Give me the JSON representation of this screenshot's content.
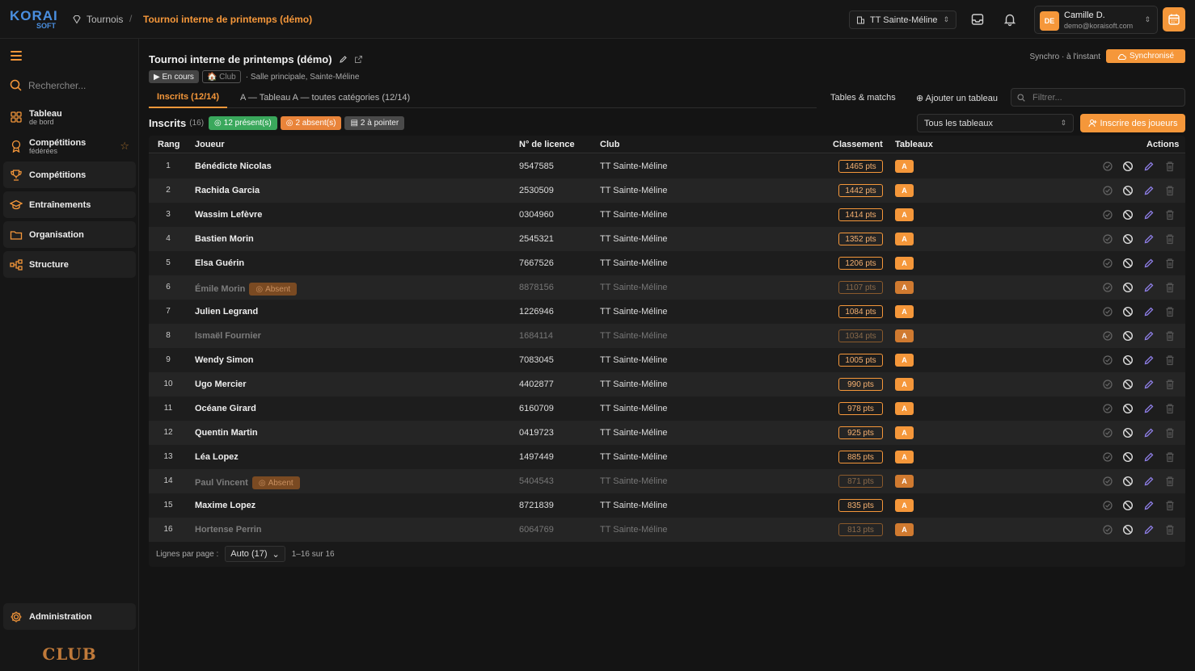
{
  "brand": {
    "logo_top": "KORAI",
    "logo_bottom": "SOFT",
    "accent": "#f5973a"
  },
  "breadcrumb": {
    "root": "Tournois",
    "separator": "/",
    "current": "Tournoi interne de printemps (démo)"
  },
  "header": {
    "club_selector": "TT Sainte-Méline",
    "user": {
      "initials": "DE",
      "name": "Camille D.",
      "email": "demo@koraisoft.com"
    }
  },
  "sidebar": {
    "search_placeholder": "Rechercher...",
    "items": [
      {
        "label": "Tableau",
        "sub": "de bord"
      },
      {
        "label": "Compétitions",
        "sub": "fédérées"
      },
      {
        "label": "Compétitions"
      },
      {
        "label": "Entraînements"
      },
      {
        "label": "Organisation"
      },
      {
        "label": "Structure"
      }
    ],
    "admin": "Administration",
    "club_logo": "CLUB"
  },
  "page": {
    "title": "Tournoi interne de printemps (démo)",
    "status_chip": "▶ En cours",
    "type_chip": "Club",
    "location": "· Salle principale, Sainte-Méline",
    "sync_label": "Synchro · à l'instant",
    "sync_button": "Synchronisé"
  },
  "tabs": {
    "active": "Inscrits (12/14)",
    "other": "A — Tableau A — toutes catégories (12/14)",
    "tables_link": "Tables & matchs",
    "add_table": "Ajouter un tableau",
    "filter_placeholder": "Filtrer..."
  },
  "inscrits": {
    "title": "Inscrits",
    "count": "(16)",
    "present": "12 présent(s)",
    "absent": "2 absent(s)",
    "to_check": "2 à pointer",
    "table_filter": "Tous les tableaux",
    "register_button": "Inscrire des joueurs",
    "absent_tag": "Absent"
  },
  "table": {
    "headers": {
      "rank": "Rang",
      "player": "Joueur",
      "license": "N° de licence",
      "club": "Club",
      "ranking": "Classement",
      "tables": "Tableaux",
      "actions": "Actions"
    },
    "rows": [
      {
        "rank": "1",
        "name": "Bénédicte Nicolas",
        "license": "9547585",
        "club": "TT Sainte-Méline",
        "pts": "1465 pts",
        "table": "A",
        "dim": false,
        "absent": false
      },
      {
        "rank": "2",
        "name": "Rachida Garcia",
        "license": "2530509",
        "club": "TT Sainte-Méline",
        "pts": "1442 pts",
        "table": "A",
        "dim": false,
        "absent": false
      },
      {
        "rank": "3",
        "name": "Wassim Lefèvre",
        "license": "0304960",
        "club": "TT Sainte-Méline",
        "pts": "1414 pts",
        "table": "A",
        "dim": false,
        "absent": false
      },
      {
        "rank": "4",
        "name": "Bastien Morin",
        "license": "2545321",
        "club": "TT Sainte-Méline",
        "pts": "1352 pts",
        "table": "A",
        "dim": false,
        "absent": false
      },
      {
        "rank": "5",
        "name": "Elsa Guérin",
        "license": "7667526",
        "club": "TT Sainte-Méline",
        "pts": "1206 pts",
        "table": "A",
        "dim": false,
        "absent": false
      },
      {
        "rank": "6",
        "name": "Émile Morin",
        "license": "8878156",
        "club": "TT Sainte-Méline",
        "pts": "1107 pts",
        "table": "A",
        "dim": true,
        "absent": true
      },
      {
        "rank": "7",
        "name": "Julien Legrand",
        "license": "1226946",
        "club": "TT Sainte-Méline",
        "pts": "1084 pts",
        "table": "A",
        "dim": false,
        "absent": false
      },
      {
        "rank": "8",
        "name": "Ismaël Fournier",
        "license": "1684114",
        "club": "TT Sainte-Méline",
        "pts": "1034 pts",
        "table": "A",
        "dim": true,
        "absent": false
      },
      {
        "rank": "9",
        "name": "Wendy Simon",
        "license": "7083045",
        "club": "TT Sainte-Méline",
        "pts": "1005 pts",
        "table": "A",
        "dim": false,
        "absent": false
      },
      {
        "rank": "10",
        "name": "Ugo Mercier",
        "license": "4402877",
        "club": "TT Sainte-Méline",
        "pts": "990 pts",
        "table": "A",
        "dim": false,
        "absent": false
      },
      {
        "rank": "11",
        "name": "Océane Girard",
        "license": "6160709",
        "club": "TT Sainte-Méline",
        "pts": "978 pts",
        "table": "A",
        "dim": false,
        "absent": false
      },
      {
        "rank": "12",
        "name": "Quentin Martin",
        "license": "0419723",
        "club": "TT Sainte-Méline",
        "pts": "925 pts",
        "table": "A",
        "dim": false,
        "absent": false
      },
      {
        "rank": "13",
        "name": "Léa Lopez",
        "license": "1497449",
        "club": "TT Sainte-Méline",
        "pts": "885 pts",
        "table": "A",
        "dim": false,
        "absent": false
      },
      {
        "rank": "14",
        "name": "Paul Vincent",
        "license": "5404543",
        "club": "TT Sainte-Méline",
        "pts": "871 pts",
        "table": "A",
        "dim": true,
        "absent": true
      },
      {
        "rank": "15",
        "name": "Maxime Lopez",
        "license": "8721839",
        "club": "TT Sainte-Méline",
        "pts": "835 pts",
        "table": "A",
        "dim": false,
        "absent": false
      },
      {
        "rank": "16",
        "name": "Hortense Perrin",
        "license": "6064769",
        "club": "TT Sainte-Méline",
        "pts": "813 pts",
        "table": "A",
        "dim": true,
        "absent": false
      }
    ],
    "footer": {
      "rows_per_page_label": "Lignes par page :",
      "rows_per_page": "Auto (17)",
      "range": "1–16 sur 16"
    }
  }
}
